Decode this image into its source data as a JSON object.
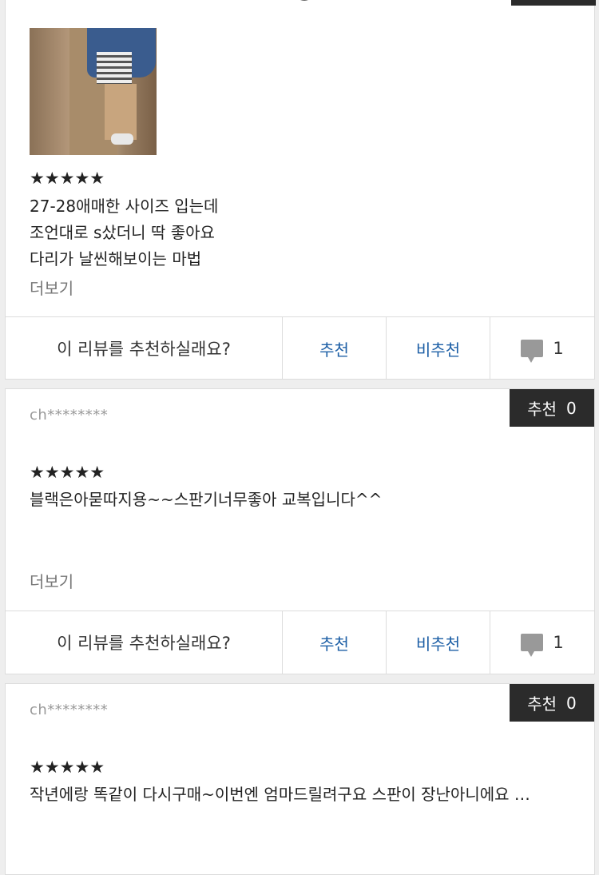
{
  "reviews": [
    {
      "stars": "★★★★★",
      "lines": [
        "27-28애매한 사이즈 입는데",
        "조언대로 s샀더니 딱 좋아요",
        "다리가 날씬해보이는 마법"
      ],
      "more": "더보기",
      "ask": "이 리뷰를 추천하실래요?",
      "recommend": "추천",
      "not_recommend": "비추천",
      "comment_count": "1"
    },
    {
      "user": "ch********",
      "badge_label": "추천",
      "badge_count": "0",
      "stars": "★★★★★",
      "lines": [
        "블랙은아묻따지용~~스판기너무좋아 교복입니다^^"
      ],
      "more": "더보기",
      "ask": "이 리뷰를 추천하실래요?",
      "recommend": "추천",
      "not_recommend": "비추천",
      "comment_count": "1"
    },
    {
      "user": "ch********",
      "badge_label": "추천",
      "badge_count": "0",
      "stars": "★★★★★",
      "lines": [
        "작년에랑 똑같이 다시구매~이번엔 엄마드릴려구요 스판이 장난아니에요 …"
      ]
    }
  ],
  "icons": {
    "comment": "comment-bubble-icon",
    "stars": "star-rating-icon"
  },
  "colors": {
    "link": "#1d5fa6",
    "badge_bg": "#2b2b2b",
    "user": "#999999",
    "more": "#777777"
  }
}
